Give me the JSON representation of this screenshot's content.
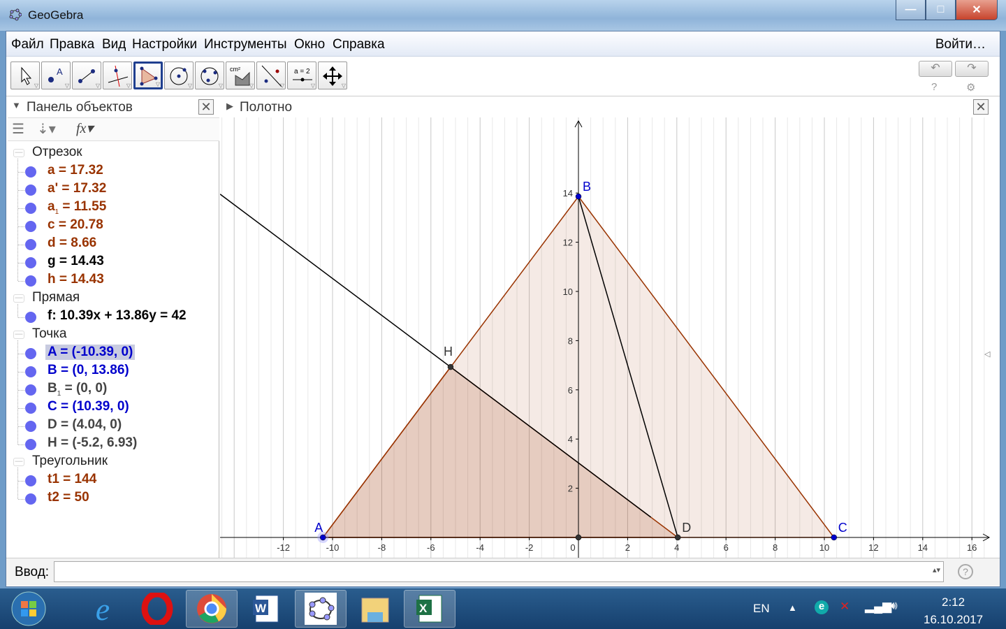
{
  "window": {
    "title": "GeoGebra",
    "minimize": "—",
    "maximize": "□",
    "close": "✕"
  },
  "menu": {
    "items": [
      "Файл",
      "Правка",
      "Вид",
      "Настройки",
      "Инструменты",
      "Окно",
      "Справка"
    ],
    "login": "Войти…"
  },
  "toolbar": {
    "tools": [
      "move",
      "point",
      "segment",
      "perpendicular-line",
      "polygon",
      "circle-center-point",
      "circle-three-points",
      "area",
      "reflect",
      "slider",
      "move-graphics-view"
    ],
    "selected": 4,
    "slider_label": "a = 2",
    "area_label": "cm²",
    "undo": "↶",
    "redo": "↷",
    "help": "?",
    "settings": "⚙"
  },
  "algebra": {
    "title": "Панель объектов",
    "close": "✕",
    "groups": [
      {
        "label": "Отрезок",
        "items": [
          {
            "name": "a",
            "sub": "",
            "value": " = 17.32",
            "color": "#993300"
          },
          {
            "name": "a'",
            "sub": "",
            "value": " = 17.32",
            "color": "#993300"
          },
          {
            "name": "a",
            "sub": "1",
            "value": " = 11.55",
            "color": "#993300"
          },
          {
            "name": "c",
            "sub": "",
            "value": " = 20.78",
            "color": "#993300"
          },
          {
            "name": "d",
            "sub": "",
            "value": " = 8.66",
            "color": "#993300"
          },
          {
            "name": "g",
            "sub": "",
            "value": " = 14.43",
            "color": "#000000"
          },
          {
            "name": "h",
            "sub": "",
            "value": " = 14.43",
            "color": "#993300"
          }
        ]
      },
      {
        "label": "Прямая",
        "items": [
          {
            "name": "f",
            "sub": "",
            "value": ": 10.39x + 13.86y = 42",
            "color": "#000000"
          }
        ]
      },
      {
        "label": "Точка",
        "items": [
          {
            "name": "A",
            "sub": "",
            "value": " = (-10.39, 0)",
            "color": "#0000cc",
            "selected": true
          },
          {
            "name": "B",
            "sub": "",
            "value": " = (0, 13.86)",
            "color": "#0000cc"
          },
          {
            "name": "B",
            "sub": "1",
            "value": " = (0, 0)",
            "color": "#444444"
          },
          {
            "name": "C",
            "sub": "",
            "value": " = (10.39, 0)",
            "color": "#0000cc"
          },
          {
            "name": "D",
            "sub": "",
            "value": " = (4.04, 0)",
            "color": "#444444"
          },
          {
            "name": "H",
            "sub": "",
            "value": " = (-5.2, 6.93)",
            "color": "#444444"
          }
        ]
      },
      {
        "label": "Треугольник",
        "items": [
          {
            "name": "t1",
            "sub": "",
            "value": " = 144",
            "color": "#993300"
          },
          {
            "name": "t2",
            "sub": "",
            "value": " = 50",
            "color": "#993300"
          }
        ]
      }
    ]
  },
  "graphics": {
    "title": "Полотно",
    "close": "✕",
    "x_ticks": [
      -12,
      -10,
      -8,
      -6,
      -4,
      -2,
      0,
      2,
      4,
      6,
      8,
      10,
      12,
      14,
      16
    ],
    "y_ticks": [
      2,
      4,
      6,
      8,
      10,
      12,
      14
    ],
    "points": [
      {
        "label": "A",
        "x": -10.39,
        "y": 0,
        "color": "#0000cc",
        "show_label": true
      },
      {
        "label": "B",
        "x": 0,
        "y": 13.86,
        "color": "#0000cc",
        "show_label": true
      },
      {
        "label": "C",
        "x": 10.39,
        "y": 0,
        "color": "#0000cc",
        "show_label": true
      },
      {
        "label": "D",
        "x": 4.04,
        "y": 0,
        "color": "#333333",
        "show_label": true
      },
      {
        "label": "H",
        "x": -5.2,
        "y": 6.93,
        "color": "#333333",
        "show_label": true
      },
      {
        "label": "B1",
        "x": 0,
        "y": 0,
        "color": "#333333",
        "show_label": false
      }
    ],
    "triangle_t1": [
      "A",
      "B",
      "C"
    ],
    "triangle_t2": [
      "A",
      "H",
      "D"
    ],
    "segment_g": [
      "B",
      "D"
    ],
    "line_f": {
      "a": 10.39,
      "b": 13.86,
      "c": 42
    },
    "polygon_color": "#993300"
  },
  "input": {
    "label": "Ввод:",
    "value": "",
    "help": "?"
  },
  "taskbar": {
    "apps": [
      "start",
      "internet-explorer",
      "opera",
      "chrome",
      "word",
      "geogebra",
      "explorer",
      "excel"
    ],
    "lang": "EN",
    "time": "2:12",
    "date": "16.10.2017"
  }
}
